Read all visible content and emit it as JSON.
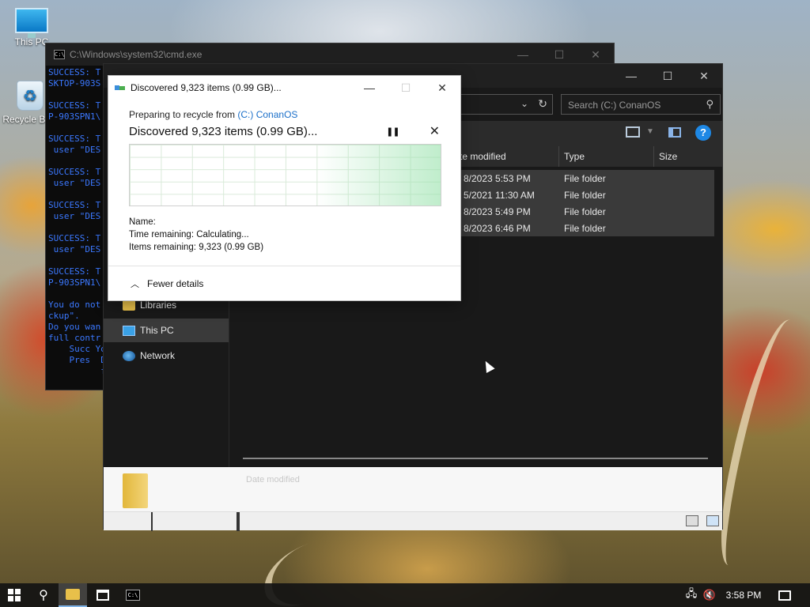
{
  "desktop": {
    "icons": [
      {
        "label": "This PC",
        "icon": "this-pc-icon"
      },
      {
        "label": "Recycle Bin",
        "icon": "recycle-bin-icon"
      }
    ]
  },
  "cmd_window": {
    "title": "C:\\Windows\\system32\\cmd.exe",
    "lines": [
      "SUCCESS: T",
      "SKTOP-903S",
      "",
      "SUCCESS: T",
      "P-903SPN1\\",
      "",
      "SUCCESS: T",
      " user \"DES",
      "",
      "SUCCESS: T",
      " user \"DES",
      "",
      "SUCCESS: T",
      " user \"DES",
      "",
      "SUCCESS: T",
      " user \"DES",
      "",
      "SUCCESS: T",
      "P-903SPN1\\",
      "",
      "You do not",
      "ckup\".",
      "Do you wan",
      "full contr",
      "    Succ You",
      "    Pres  Do",
      "          ful"
    ]
  },
  "explorer": {
    "search_placeholder": "Search (C:) ConanOS",
    "columns": {
      "date": "te modified",
      "type": "Type",
      "size": "Size"
    },
    "rows": [
      {
        "date": "8/2023 5:53 PM",
        "type": "File folder"
      },
      {
        "date": "5/2021 11:30 AM",
        "type": "File folder"
      },
      {
        "date": "8/2023 5:49 PM",
        "type": "File folder"
      },
      {
        "date": "8/2023 6:46 PM",
        "type": "File folder"
      }
    ],
    "nav": [
      {
        "label": "Libraries",
        "icon": "libraries-icon"
      },
      {
        "label": "This PC",
        "icon": "this-pc-icon",
        "selected": true
      },
      {
        "label": "Network",
        "icon": "network-icon"
      }
    ],
    "details_faded": "Date modified"
  },
  "dialog": {
    "title": "Discovered 9,323 items (0.99 GB)...",
    "preparing_prefix": "Preparing to recycle from ",
    "preparing_link": "(C:) ConanOS",
    "status": "Discovered 9,323 items (0.99 GB)...",
    "name_label": "Name:",
    "time_label": "Time remaining:",
    "time_value": "Calculating...",
    "items_label": "Items remaining:",
    "items_value": "9,323 (0.99 GB)",
    "fewer_details": "Fewer details"
  },
  "taskbar": {
    "clock": "3:58 PM"
  },
  "colors": {
    "link": "#1a6fc9",
    "cmd_text": "#3b78ff",
    "taskbar": "#141414"
  }
}
